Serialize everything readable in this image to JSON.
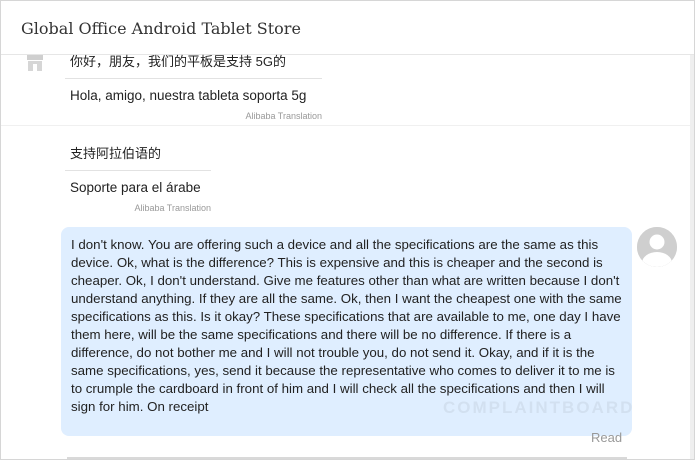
{
  "header": {
    "title": "Global Office Android Tablet Store"
  },
  "messages_in": [
    {
      "original": "你好，朋友，我们的平板是支持 5G的",
      "translation": "Hola, amigo, nuestra tableta soporta 5g",
      "source": "Alibaba Translation"
    },
    {
      "original": "支持阿拉伯语的",
      "translation": "Soporte para el árabe",
      "source": "Alibaba Translation"
    }
  ],
  "message_out": {
    "text": "I don't know. You are offering such a device and all the specifications are the same as this device. Ok, what is the difference? This is expensive and this is cheaper and the second is cheaper. Ok, I don't understand. Give me features other than what are written because I don't understand anything. If they are all the same. Ok, then I want the cheapest one with the same specifications as this. Is it okay? These specifications that are available to me, one day I have them here, will be the same specifications and there will be no difference. If there is a difference, do not bother me and I will not trouble you, do not send it. Okay, and if it is the same specifications, yes, send it because the representative who comes to deliver it to me is to crumple the cardboard in front of him and I will check all the specifications and then I will sign for him. On receipt",
    "status": "Read"
  },
  "watermark": {
    "text": "COMPLAINTBOARD"
  },
  "icons": {
    "store": "store-icon",
    "avatar": "user-avatar-icon"
  },
  "colors": {
    "bubble_out": "#dfeeff",
    "muted": "#999999"
  }
}
